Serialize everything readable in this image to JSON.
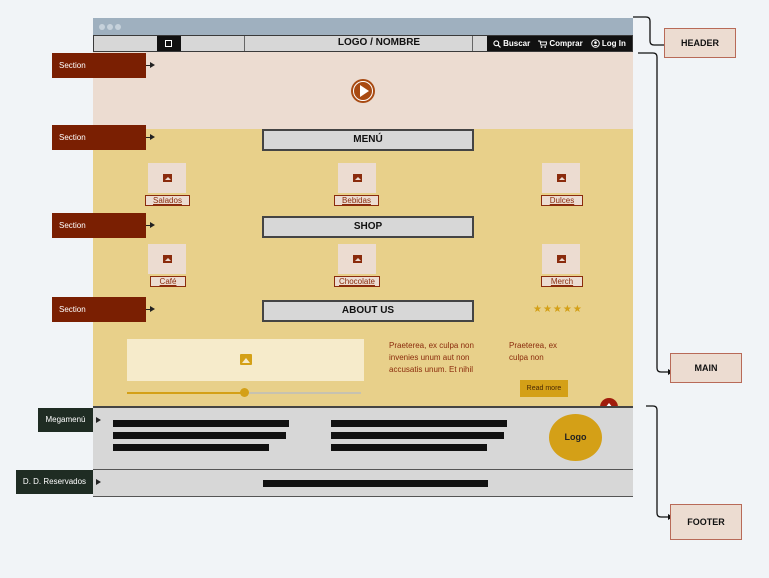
{
  "nav": {
    "logo_text": "LOGO / NOMBRE",
    "search": "Buscar",
    "buy": "Comprar",
    "login": "Log In",
    "icons": [
      "menu-icon",
      "search-icon",
      "cart-icon",
      "user-icon"
    ]
  },
  "sections": {
    "label": "Section",
    "menu_title": "MENÚ",
    "shop_title": "SHOP",
    "about_title": "ABOUT US"
  },
  "menu_items": [
    "Salados",
    "Bebidas",
    "Dulces"
  ],
  "shop_items": [
    "Café",
    "Chocolate",
    "Merch"
  ],
  "about": {
    "text1": "Praeterea, ex culpa non invenies unum aut non accusatis unum. Et nihil",
    "text2": "Praeterea, ex culpa non",
    "read_more": "Read more",
    "stars": "★★★★★",
    "slider_value": 0.5
  },
  "footer": {
    "logo": "Logo"
  },
  "side_labels": {
    "megamenu": "Megamenú",
    "reserved": "D. D. Reservados"
  },
  "zones": {
    "header": "HEADER",
    "main": "MAIN",
    "footer": "FOOTER"
  },
  "colors": {
    "accent_dark_red": "#7a1f02",
    "main_yellow": "#e8d08a",
    "gold": "#d4a017"
  }
}
